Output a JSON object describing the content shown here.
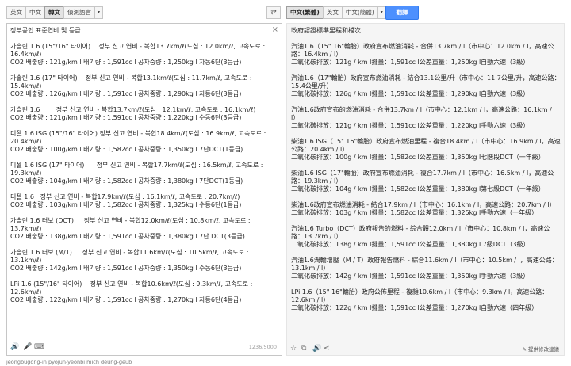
{
  "source_langs": [
    {
      "label": "英文",
      "active": false
    },
    {
      "label": "中文",
      "active": false
    },
    {
      "label": "韓文",
      "active": true
    },
    {
      "label": "偵測語言",
      "active": false
    }
  ],
  "target_langs": [
    {
      "label": "中文(繁體)",
      "active": true
    },
    {
      "label": "英文",
      "active": false
    },
    {
      "label": "中文(簡體)",
      "active": false
    }
  ],
  "dropdown_glyph": "▾",
  "swap_glyph": "⇄",
  "translate_label": "翻譯",
  "clear_glyph": "×",
  "source_text": "정부공인 표준연비 및 등급\n\n가솔린 1.6 (15\"/16\" 타이어)    정부 신고 연비 - 복합13.7km/ℓ(도심 : 12.0km/ℓ, 고속도로 : 16.4km/ℓ)\nCO2 배출량 : 121g/km l 배기량 : 1,591cc l 공차중량 : 1,250kg l 자동6단(3등급)\n\n가솔린 1.6 (17\" 타이어)    정부 신고 연비 - 복합13.1km/ℓ(도심 : 11.7km/ℓ, 고속도로 : 15.4km/ℓ)\nCO2 배출량 : 126g/km l 배기량 : 1,591cc l 공차중량 : 1,290kg l 자동6단(3등급)\n\n가솔린 1.6        정부 신고 연비 - 복합13.7km/ℓ(도심 : 12.1km/ℓ, 고속도로 : 16.1km/ℓ)\nCO2 배출량 : 121g/km l 배기량 : 1,591cc l 공차중량 : 1,220kg l 수동6단(3등급)\n\n디젤 1.6 ISG (15\"/16\" 타이어) 정부 신고 연비 - 복합18.4km/ℓ(도심 : 16.9km/ℓ, 고속도로 : 20.4km/ℓ)\nCO2 배출량 : 100g/km l 배기량 : 1,582cc l 공차중량 : 1,350kg l 7단DCT(1등급)\n\n디젤 1.6 ISG (17\" 타이어)      정부 신고 연비 - 복합17.7km/ℓ(도심 : 16.5km/ℓ, 고속도로 : 19.3km/ℓ)\nCO2 배출량 : 104g/km l 배기량 : 1,582cc l 공차중량 : 1,380kg l 7단DCT(1등급)\n\n디젤 1.6   정부 신고 연비 - 복합17.9km/ℓ(도심 : 16.1km/ℓ, 고속도로 : 20.7km/ℓ)\nCO2 배출량 : 103g/km l 배기량 : 1,582cc l 공차중량 : 1,325kg l 수동6단(1등급)\n\n가솔린 1.6 터보 (DCT)     정부 신고 연비 - 복합12.0km/ℓ(도심 : 10.8km/ℓ, 고속도로 : 13.7km/ℓ)\nCO2 배출량 : 138g/km l 배기량 : 1,591cc l 공차중량 : 1,380kg l 7단 DCT(3등급)\n\n가솔린 1.6 터보 (M/T)     정부 신고 연비 - 복합11.6km/ℓ(도심 : 10.5km/ℓ, 고속도로 : 13.1km/ℓ)\nCO2 배출량 : 142g/km l 배기량 : 1,591cc l 공차중량 : 1,350kg l 수동6단(3등급)\n\nLPi 1.6 (15\"/16\" 타이어)    정부 신고 연비 - 복합10.6km/ℓ(도심 : 9.3km/ℓ, 고속도로 : 12.6km/ℓ)\nCO2 배출량 : 122g/km l 배기량 : 1,591cc l 공차중량 : 1,270kg l 자동6단(4등급)",
  "char_count": "1236/5000",
  "romanization": "jeongbugong-in pyojun-yeonbi mich deung-geub",
  "target_text": "政府認證標準里程和檔次\n\n汽油1.6（15\" 16\"輪胎）政府宣布燃油消耗 - 合併13.7km / l（市中心：12.0km / l，高速公路：16.4km / l）\n二氧化碳排放：121g / km l排量：1,591cc l公差重量：1,250kg l自動六速（3級）\n\n汽油1.6（17\"輪胎）政府宣布燃油消耗 - 結合13.1公里/升（市中心：11.7公里/升，高速公路：15.4公里/升）\n二氧化碳排放：126g / km l排量：1,591cc l公差重量：1,290kg l自動六速（3級）\n\n汽油1.6政府宣布的燃油消耗 - 合併13.7km / l（市中心：12.1km / l，高速公路：16.1km / l）\n二氧化碳排放：121g / km l排量：1,591cc l公差重量：1,220kg l手動六速（3級）\n\n柴油1.6 ISG（15\" 16\"輪胎）政府宣布燃油里程 - 複合18.4km / l（市中心：16.9km / l，高速公路：20.4km / l）\n二氧化碳排放：100g / km l排量：1,582cc l公差重量：1,350kg l七階段DCT（一年級）\n\n柴油1.6 ISG（17\"輪胎）政府宣布燃油消耗 - 複合17.7km / l（市中心：16.5km / l，高速公路：19.3km / l）\n二氧化碳排放：104g / km l排量：1,582cc l公差重量：1,380kg l第七級DCT（一年級）\n\n柴油1.6政府宣布燃油消耗 - 結合17.9km / l（市中心：16.1km / l，高速公路：20.7km / l）\n二氧化碳排放：103g / km l排量：1,582cc l公差重量：1,325kg l手動六速（一年級）\n\n汽油1.6 Turbo（DCT）政府報告的燃料 - 綜合體12.0km / l（市中心：10.8km / l，高速公路：13.7km / l）\n二氧化碳排放：138g / km l排量：1,591cc l公差重量：1,380kg l 7級DCT（3級）\n\n汽油1.6渦輪增壓（M / T）政府報告燃料 - 綜合11.6km / l（市中心：10.5km / l，高速公路：13.1km / l）\n二氧化碳排放：142g / km l排量：1,591cc l公差重量：1,350kg l手動六速（3級）\n\nLPi 1.6（15\" 16\"輪胎）政府公佈里程 - 複雜10.6km / l（市中心：9.3km / l，高速公路：12.6km / l）\n二氧化碳排放：122g / km l排量：1,591cc l公差重量：1,270kg l自動六速（四年級）",
  "suggest_label": "✎ 提供修改建議",
  "icons": {
    "speaker": "🔊",
    "mic": "🎤",
    "keyboard": "⌨",
    "star": "☆",
    "copy": "⧉",
    "share": "⋖"
  }
}
